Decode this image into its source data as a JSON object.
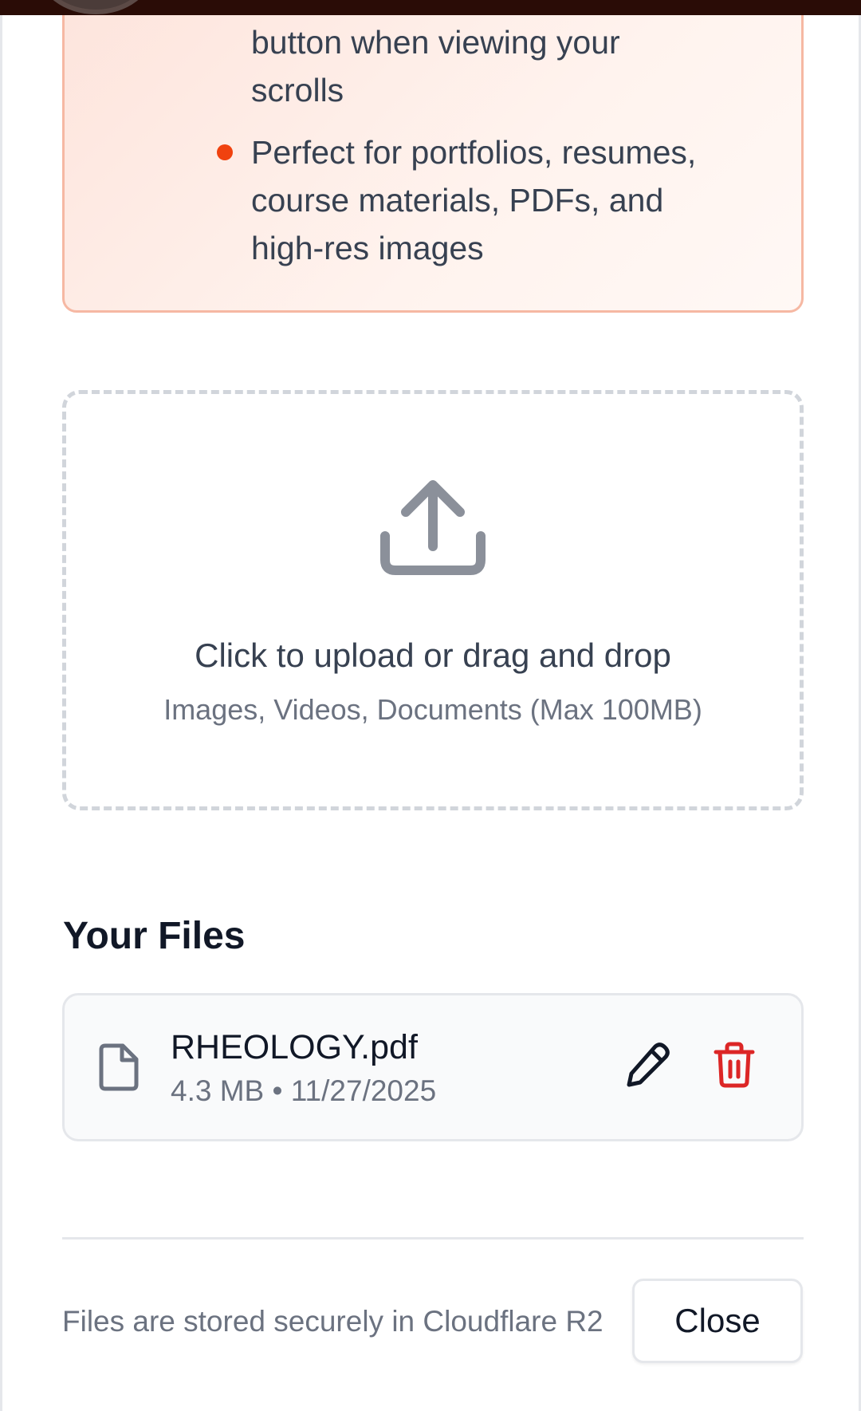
{
  "notice": {
    "lines": [
      "button when viewing your",
      "scrolls",
      "Perfect for portfolios, resumes,",
      "course materials, PDFs, and",
      "high-res images"
    ]
  },
  "upload": {
    "title": "Click to upload or drag and drop",
    "subtitle": "Images, Videos, Documents (Max 100MB)",
    "icon": "upload-icon"
  },
  "files": {
    "heading": "Your Files",
    "items": [
      {
        "name": "RHEOLOGY.pdf",
        "meta": "4.3 MB • 11/27/2025",
        "icon": "file-icon"
      }
    ]
  },
  "footer": {
    "note": "Files are stored securely in Cloudflare R2",
    "close_label": "Close"
  },
  "colors": {
    "accent": "#f0420f",
    "notice_border": "#f6b8a3",
    "delete": "#dc2626",
    "text": "#374151",
    "muted": "#6b7280"
  }
}
